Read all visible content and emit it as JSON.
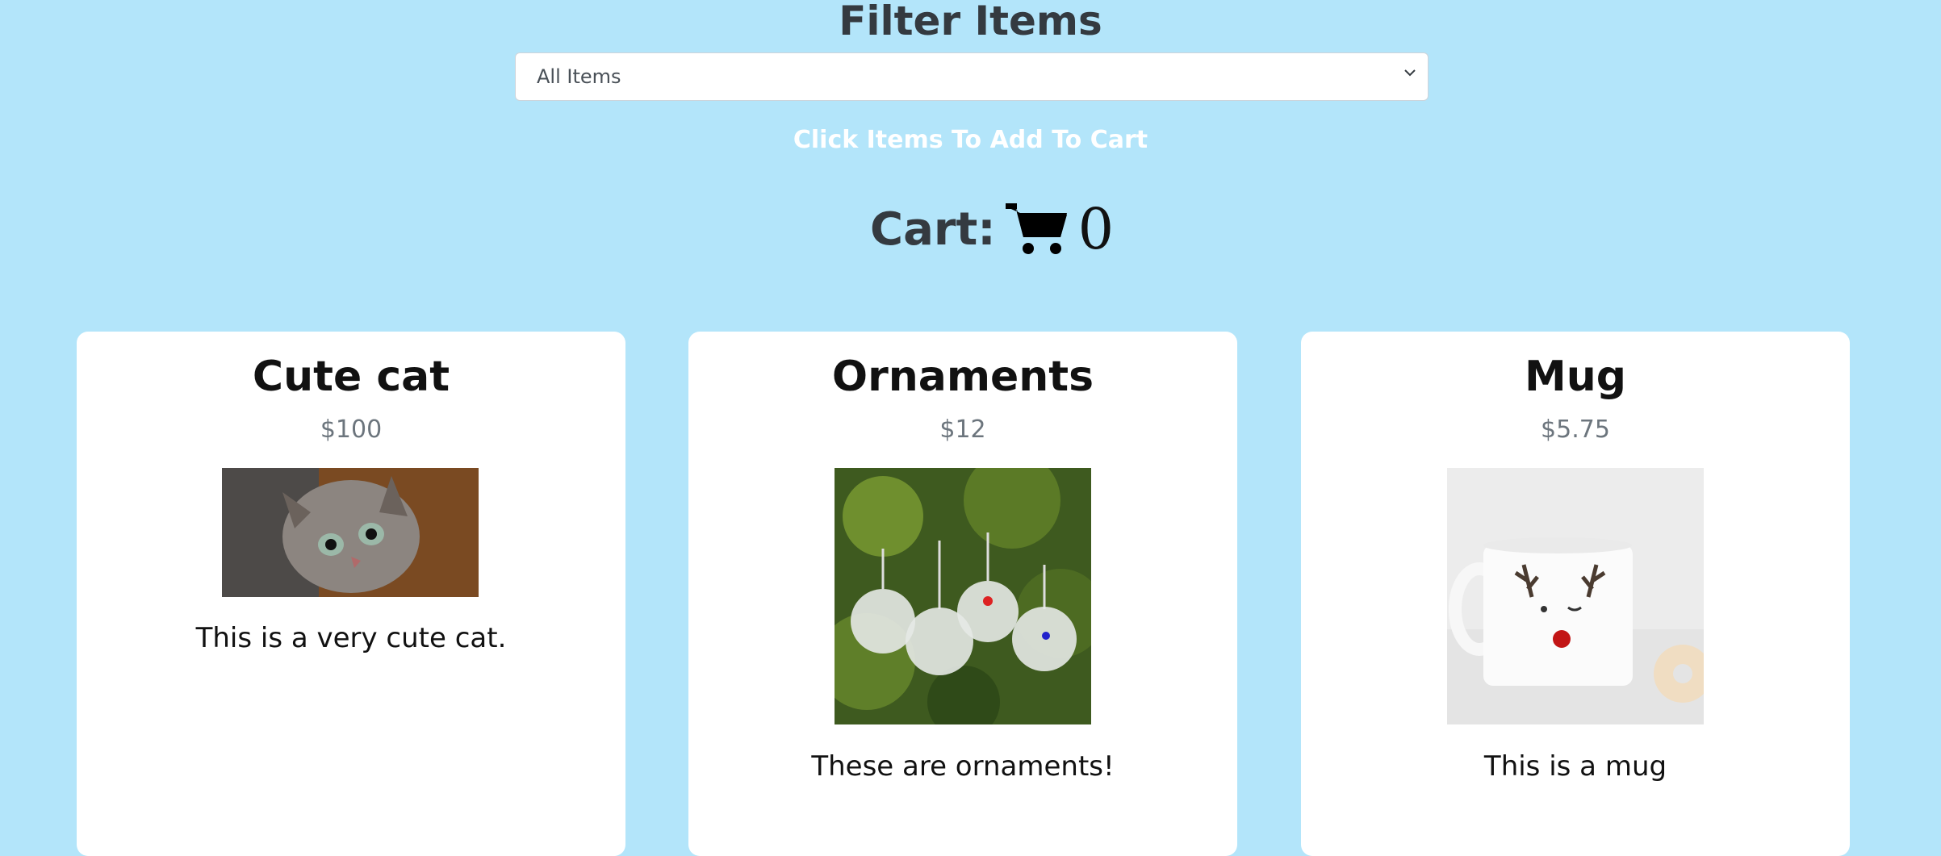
{
  "header": {
    "title": "Filter Items",
    "filter_selected": "All Items",
    "hint": "Click Items To Add To Cart",
    "cart_label": "Cart:",
    "cart_count": "0"
  },
  "items": [
    {
      "title": "Cute cat",
      "price": "$100",
      "description": "This is a very cute cat.",
      "image": "cat-photo"
    },
    {
      "title": "Ornaments",
      "price": "$12",
      "description": "These are ornaments!",
      "image": "ornaments-photo"
    },
    {
      "title": "Mug",
      "price": "$5.75",
      "description": "This is a mug",
      "image": "mug-photo"
    }
  ],
  "colors": {
    "background": "#b3e5fa",
    "card": "#ffffff"
  }
}
